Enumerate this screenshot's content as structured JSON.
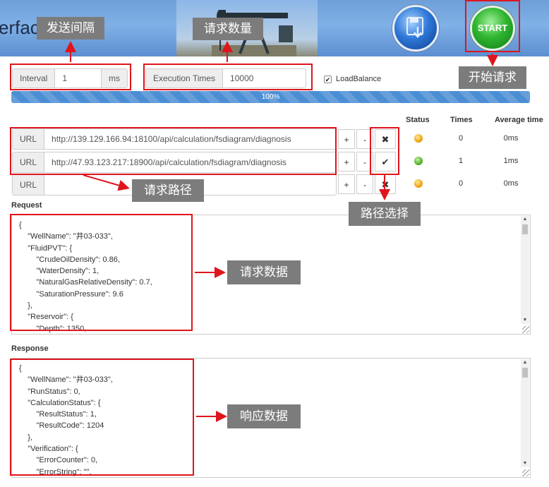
{
  "header": {
    "title_fragment": "erfac",
    "start_label": "START"
  },
  "controls": {
    "interval": {
      "label": "Interval",
      "value": "1",
      "unit": "ms"
    },
    "execution": {
      "label": "Execution Times",
      "value": "10000"
    },
    "loadbalance": {
      "label": "LoadBalance",
      "checked": true
    },
    "progress": {
      "value": 1.0,
      "label": "100%"
    }
  },
  "columns": {
    "status": "Status",
    "times": "Times",
    "avg": "Average time"
  },
  "urls": [
    {
      "label": "URL",
      "value": "http://139.129.166.94:18100/api/calculation/fsdiagram/diagnosis",
      "plus": "+",
      "minus": "-",
      "toggle": "✖",
      "status": "yellow",
      "times": "0",
      "avg": "0ms"
    },
    {
      "label": "URL",
      "value": "http://47.93.123.217:18900/api/calculation/fsdiagram/diagnosis",
      "plus": "+",
      "minus": "-",
      "toggle": "✔",
      "status": "green",
      "times": "1",
      "avg": "1ms"
    },
    {
      "label": "URL",
      "value": "",
      "plus": "+",
      "minus": "-",
      "toggle": "✖",
      "status": "yellow",
      "times": "0",
      "avg": "0ms"
    }
  ],
  "request": {
    "label": "Request",
    "text": "{\n    \"WellName\": \"井03-033\",\n    \"FluidPVT\": {\n        \"CrudeOilDensity\": 0.86,\n        \"WaterDensity\": 1,\n        \"NaturalGasRelativeDensity\": 0.7,\n        \"SaturationPressure\": 9.6\n    },\n    \"Reservoir\": {\n        \"Depth\": 1350,"
  },
  "response": {
    "label": "Response",
    "text": "{\n    \"WellName\": \"井03-033\",\n    \"RunStatus\": 0,\n    \"CalculationStatus\": {\n        \"ResultStatus\": 1,\n        \"ResultCode\": 1204\n    },\n    \"Verification\": {\n        \"ErrorCounter\": 0,\n        \"ErrorString\": \"\","
  },
  "annotations": {
    "send_interval": "发送间隔",
    "request_count": "请求数量",
    "start_request": "开始请求",
    "request_path": "请求路径",
    "path_select": "路径选择",
    "request_data": "请求数据",
    "response_data": "响应数据"
  },
  "colors": {
    "annotation_red": "#e0141c",
    "annotation_tag": "#7c7c7c",
    "progress": "#4b8ed3"
  }
}
